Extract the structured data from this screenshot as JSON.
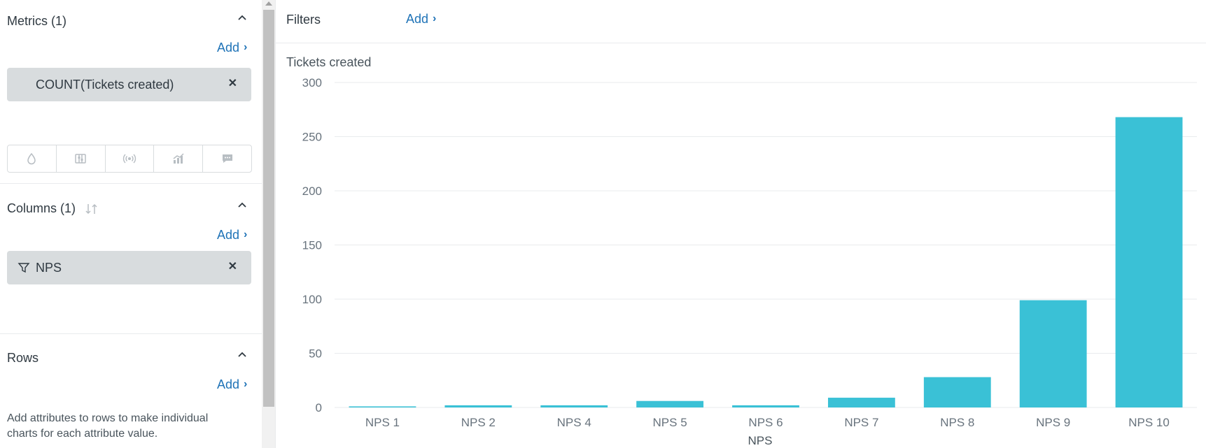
{
  "metrics": {
    "title": "Metrics (1)",
    "add_label": "Add",
    "items": [
      {
        "label": "COUNT(Tickets created)"
      }
    ],
    "toolbar_icons": [
      "drop-icon",
      "sliders-icon",
      "broadcast-icon",
      "chart-icon",
      "chat-icon"
    ]
  },
  "columns": {
    "title": "Columns (1)",
    "add_label": "Add",
    "items": [
      {
        "label": "NPS",
        "icon": "filter-icon"
      }
    ]
  },
  "rows": {
    "title": "Rows",
    "add_label": "Add",
    "helper_text": "Add attributes to rows to make individual charts for each attribute value."
  },
  "filters": {
    "label": "Filters",
    "add_label": "Add"
  },
  "colors": {
    "bar": "#3ac1d6",
    "link": "#1f73b7",
    "pill": "#d8dcde"
  },
  "chart_data": {
    "type": "bar",
    "title": "Tickets created",
    "xlabel": "NPS",
    "ylabel": "",
    "categories": [
      "NPS 1",
      "NPS 2",
      "NPS 4",
      "NPS 5",
      "NPS 6",
      "NPS 7",
      "NPS 8",
      "NPS 9",
      "NPS 10"
    ],
    "values": [
      1,
      2,
      2,
      6,
      2,
      9,
      28,
      99,
      268
    ],
    "ylim": [
      0,
      300
    ],
    "yticks": [
      0,
      50,
      100,
      150,
      200,
      250,
      300
    ],
    "grid": true,
    "legend": "none"
  }
}
